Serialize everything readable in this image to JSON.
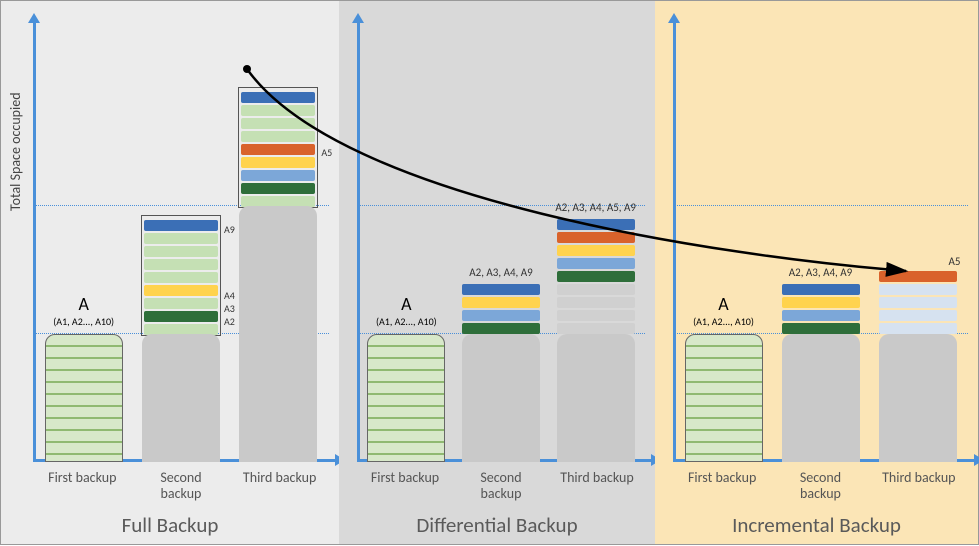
{
  "yAxisLabel": "Total Space occupied",
  "panels": [
    {
      "key": "full",
      "title": "Full Backup",
      "barLabels": [
        "First backup",
        "Second backup",
        "Third backup"
      ],
      "columnA": {
        "titleBig": "A",
        "titleSmall": "(A1, A2..., A10)"
      },
      "sideAnnos": {
        "a2": "A2",
        "a3": "A3",
        "a4": "A4",
        "a9": "A9",
        "a5": "A5"
      }
    },
    {
      "key": "diff",
      "title": "Differential Backup",
      "barLabels": [
        "First backup",
        "Second backup",
        "Third backup"
      ],
      "columnA": {
        "titleBig": "A",
        "titleSmall": "(A1, A2..., A10)"
      },
      "stack2Anno": "A2, A3, A4, A9",
      "stack3Anno": "A2, A3, A4, A5, A9"
    },
    {
      "key": "incr",
      "title": "Incremental Backup",
      "barLabels": [
        "First backup",
        "Second backup",
        "Third backup"
      ],
      "columnA": {
        "titleBig": "A",
        "titleSmall": "(A1, A2..., A10)"
      },
      "stack2Anno": "A2, A3, A4, A9",
      "stack3Anno": "A5"
    }
  ],
  "chart_data": {
    "type": "bar",
    "description": "Three conceptual stacked-bar diagrams comparing storage space for Full, Differential and Incremental backup strategies across three backup events. Dataset A has blocks A1..A10. Changed blocks after first backup: A2,A3,A4,A9. Additional change after second backup: A5.",
    "ylabel": "Total Space occupied",
    "series": [
      {
        "name": "Full Backup",
        "categories": [
          "First backup",
          "Second backup",
          "Third backup"
        ],
        "stored_blocks": [
          [
            "A1",
            "A2",
            "A3",
            "A4",
            "A5",
            "A6",
            "A7",
            "A8",
            "A9",
            "A10"
          ],
          [
            "A1",
            "A2",
            "A3",
            "A4",
            "A5",
            "A6",
            "A7",
            "A8",
            "A9",
            "A10"
          ],
          [
            "A1",
            "A2",
            "A3",
            "A4",
            "A5",
            "A6",
            "A7",
            "A8",
            "A9",
            "A10"
          ]
        ],
        "cumulative_blocks": [
          10,
          20,
          30
        ]
      },
      {
        "name": "Differential Backup",
        "categories": [
          "First backup",
          "Second backup",
          "Third backup"
        ],
        "stored_blocks": [
          [
            "A1",
            "A2",
            "A3",
            "A4",
            "A5",
            "A6",
            "A7",
            "A8",
            "A9",
            "A10"
          ],
          [
            "A2",
            "A3",
            "A4",
            "A9"
          ],
          [
            "A2",
            "A3",
            "A4",
            "A5",
            "A9"
          ]
        ],
        "cumulative_blocks": [
          10,
          14,
          19
        ]
      },
      {
        "name": "Incremental Backup",
        "categories": [
          "First backup",
          "Second backup",
          "Third backup"
        ],
        "stored_blocks": [
          [
            "A1",
            "A2",
            "A3",
            "A4",
            "A5",
            "A6",
            "A7",
            "A8",
            "A9",
            "A10"
          ],
          [
            "A2",
            "A3",
            "A4",
            "A9"
          ],
          [
            "A5"
          ]
        ],
        "cumulative_blocks": [
          10,
          14,
          15
        ]
      }
    ],
    "colors": {
      "unchanged": "#c5e0b4",
      "A2": "#2e6e3a",
      "A3": "#c5e0b4",
      "A4": "#ffd34e",
      "A5": "#d9622b",
      "A9": "#3b6fb6",
      "prior_grey": "#c9c9c9"
    }
  }
}
